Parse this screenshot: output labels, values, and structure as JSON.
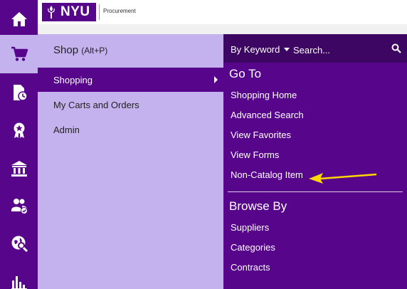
{
  "header": {
    "logo_text": "NYU",
    "logo_subtitle": "Procurement"
  },
  "rail": {
    "items": [
      {
        "icon": "home-icon"
      },
      {
        "icon": "cart-icon"
      },
      {
        "icon": "document-clock-icon"
      },
      {
        "icon": "award-ribbon-icon"
      },
      {
        "icon": "bank-icon"
      },
      {
        "icon": "users-check-icon"
      },
      {
        "icon": "globe-search-icon"
      },
      {
        "icon": "bar-chart-icon"
      }
    ]
  },
  "shop_menu": {
    "title": "Shop",
    "hotkey": "(Alt+P)",
    "items": [
      {
        "label": "Shopping"
      },
      {
        "label": "My Carts and Orders"
      },
      {
        "label": "Admin"
      }
    ]
  },
  "search": {
    "mode_label": "By Keyword",
    "placeholder": "Search..."
  },
  "goto": {
    "title": "Go To",
    "links": [
      {
        "label": "Shopping Home"
      },
      {
        "label": "Advanced Search"
      },
      {
        "label": "View Favorites"
      },
      {
        "label": "View Forms"
      },
      {
        "label": "Non-Catalog Item"
      }
    ]
  },
  "browse": {
    "title": "Browse By",
    "links": [
      {
        "label": "Suppliers"
      },
      {
        "label": "Categories"
      },
      {
        "label": "Contracts"
      }
    ]
  },
  "colors": {
    "nyu_purple": "#57068c",
    "menu_lavender": "#c4b2ee",
    "arrow_yellow": "#ffd700"
  }
}
